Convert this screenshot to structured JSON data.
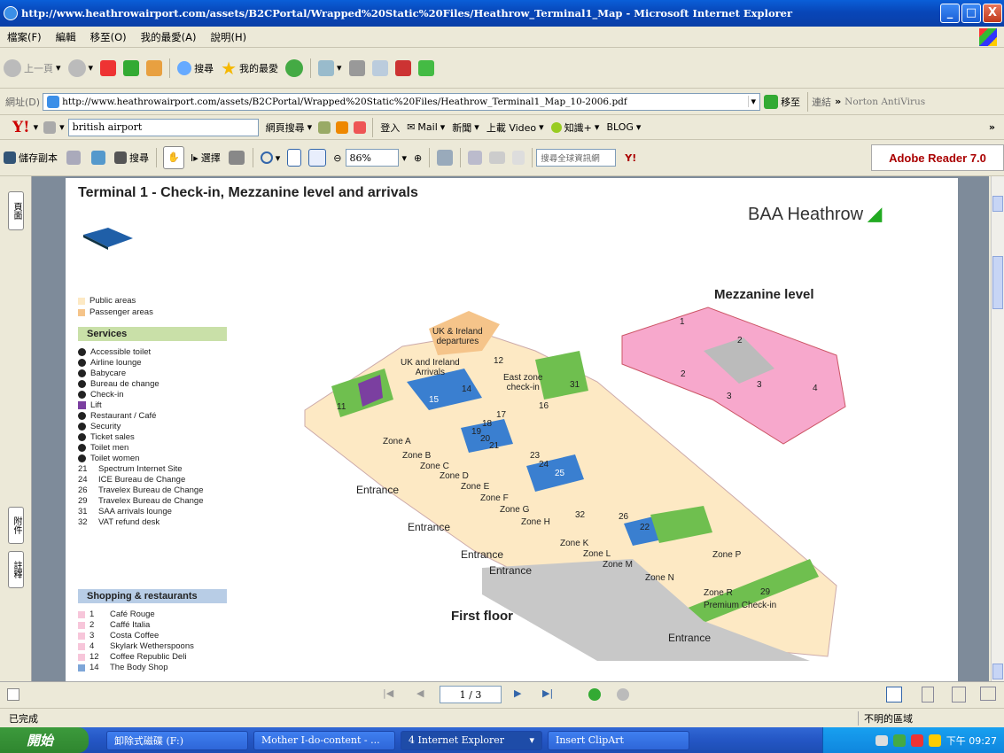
{
  "window": {
    "title": "http://www.heathrowairport.com/assets/B2CPortal/Wrapped%20Static%20Files/Heathrow_Terminal1_Map - Microsoft Internet Explorer",
    "buttons": {
      "minimize": "_",
      "maximize": "□",
      "close": "X"
    }
  },
  "menu": {
    "items": [
      "檔案(F)",
      "編輯",
      "移至(O)",
      "我的最愛(A)",
      "說明(H)"
    ]
  },
  "toolbar": {
    "back": "上一頁",
    "search": "搜尋",
    "favorites": "我的最愛"
  },
  "address": {
    "label": "網址(D)",
    "url": "http://www.heathrowairport.com/assets/B2CPortal/Wrapped%20Static%20Files/Heathrow_Terminal1_Map_10-2006.pdf",
    "go": "移至",
    "links": "連結",
    "chevron": "»",
    "norton": "Norton AntiVirus"
  },
  "yahoo_bar": {
    "search_value": "british airport",
    "web_search": "網頁搜尋",
    "login": "登入",
    "mail": "Mail",
    "news": "新聞",
    "upload": "上載 Video",
    "knowledge": "知識+",
    "blog": "BLOG",
    "more": "»"
  },
  "reader_bar": {
    "save_copy": "儲存副本",
    "search": "搜尋",
    "select": "選擇",
    "zoom": "86%",
    "global_search": "搜尋全球資訊網",
    "brand": "Adobe Reader 7.0"
  },
  "side_tabs": {
    "pages": "頁面",
    "attachments": "附件",
    "comments": "註釋"
  },
  "map": {
    "title": "Terminal 1 - Check-in, Mezzanine level and arrivals",
    "brand": "BAA Heathrow",
    "mezzanine": "Mezzanine level",
    "first_floor": "First floor",
    "legend_areas": [
      "Public areas",
      "Passenger areas"
    ],
    "services_header": "Services",
    "services": [
      "Accessible toilet",
      "Airline lounge",
      "Babycare",
      "Bureau de change",
      "Check-in",
      "Lift",
      "Restaurant / Café",
      "Security",
      "Ticket sales",
      "Toilet men",
      "Toilet women"
    ],
    "services_numbered": [
      {
        "n": "21",
        "label": "Spectrum Internet Site"
      },
      {
        "n": "24",
        "label": "ICE Bureau de Change"
      },
      {
        "n": "26",
        "label": "Travelex Bureau de Change"
      },
      {
        "n": "29",
        "label": "Travelex Bureau de Change"
      },
      {
        "n": "31",
        "label": "SAA arrivals lounge"
      },
      {
        "n": "32",
        "label": "VAT refund desk"
      }
    ],
    "shopping_header": "Shopping & restaurants",
    "shopping": [
      {
        "n": "1",
        "label": "Café Rouge"
      },
      {
        "n": "2",
        "label": "Caffé Italia"
      },
      {
        "n": "3",
        "label": "Costa Coffee"
      },
      {
        "n": "4",
        "label": "Skylark Wetherspoons"
      },
      {
        "n": "12",
        "label": "Coffee Republic Deli"
      },
      {
        "n": "14",
        "label": "The Body Shop"
      }
    ],
    "labels": {
      "uk_departures": "UK & Ireland\ndepartures",
      "uk_arrivals": "UK and Ireland\nArrivals",
      "east_zone": "East zone\ncheck-in",
      "entrance": "Entrance",
      "premium": "Premium Check-in",
      "zones": [
        "Zone A",
        "Zone B",
        "Zone C",
        "Zone D",
        "Zone E",
        "Zone F",
        "Zone G",
        "Zone H",
        "Zone K",
        "Zone L",
        "Zone M",
        "Zone N",
        "Zone P",
        "Zone R"
      ],
      "numbers": [
        "1",
        "2",
        "3",
        "4",
        "2",
        "3",
        "11",
        "12",
        "14",
        "15",
        "16",
        "17",
        "18",
        "19",
        "20",
        "21",
        "22",
        "23",
        "24",
        "25",
        "26",
        "29",
        "31",
        "32"
      ]
    }
  },
  "nav": {
    "page": "1 / 3"
  },
  "status": {
    "left": "已完成",
    "right": "不明的區域"
  },
  "taskbar": {
    "start": "開始",
    "tasks": [
      "卸除式磁碟 (F:)",
      "Mother I-do-content - ...",
      "4 Internet Explorer",
      "Insert ClipArt"
    ],
    "clock": "下午 09:27"
  }
}
